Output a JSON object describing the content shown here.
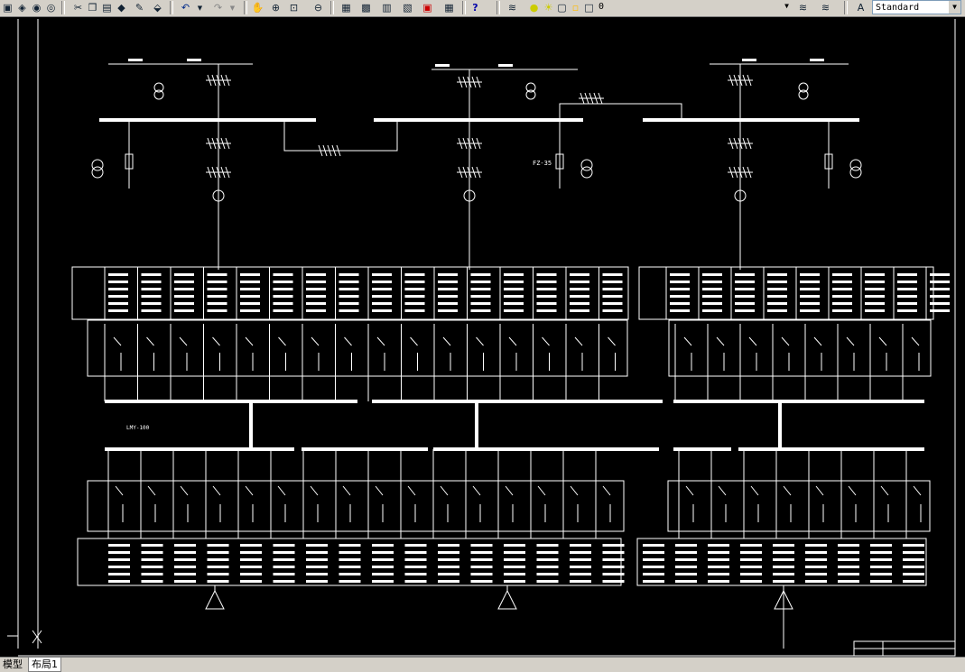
{
  "toolbar": {
    "layer_value": "0",
    "text_style_value": "Standard",
    "help_label": "?"
  },
  "tabs": [
    {
      "label": "模型"
    },
    {
      "label": "布局1"
    }
  ],
  "drawing": {
    "labels": {
      "fz_35": "FZ-35",
      "lmy": "LMY-100"
    }
  }
}
